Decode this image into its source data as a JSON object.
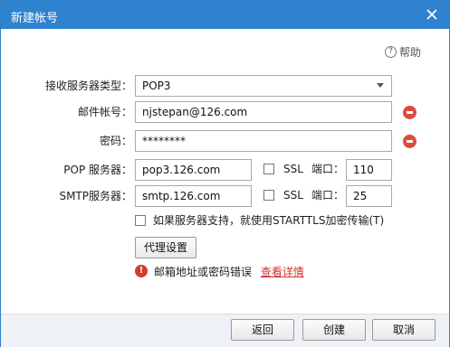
{
  "window": {
    "title": "新建帐号"
  },
  "help": {
    "label": "帮助"
  },
  "form": {
    "server_type_label": "接收服务器类型：",
    "server_type_value": "POP3",
    "email_label": "邮件帐号：",
    "email_value": "njstepan@126.com",
    "password_label": "密码：",
    "password_value": "********",
    "pop_label": "POP 服务器：",
    "pop_value": "pop3.126.com",
    "pop_ssl_label": "SSL",
    "pop_port_label": "端口：",
    "pop_port_value": "110",
    "smtp_label": "SMTP服务器：",
    "smtp_value": "smtp.126.com",
    "smtp_ssl_label": "SSL",
    "smtp_port_label": "端口：",
    "smtp_port_value": "25",
    "starttls_label": "如果服务器支持，就使用STARTTLS加密传输(T)",
    "proxy_button": "代理设置",
    "error_text": "邮箱地址或密码错误",
    "error_link": "查看详情"
  },
  "footer": {
    "back_button": "返回",
    "create_button": "创建",
    "cancel_button": "取消"
  },
  "colors": {
    "titlebar": "#2f82cf",
    "error": "#d0312d",
    "footer_bg": "#eef1f5"
  }
}
